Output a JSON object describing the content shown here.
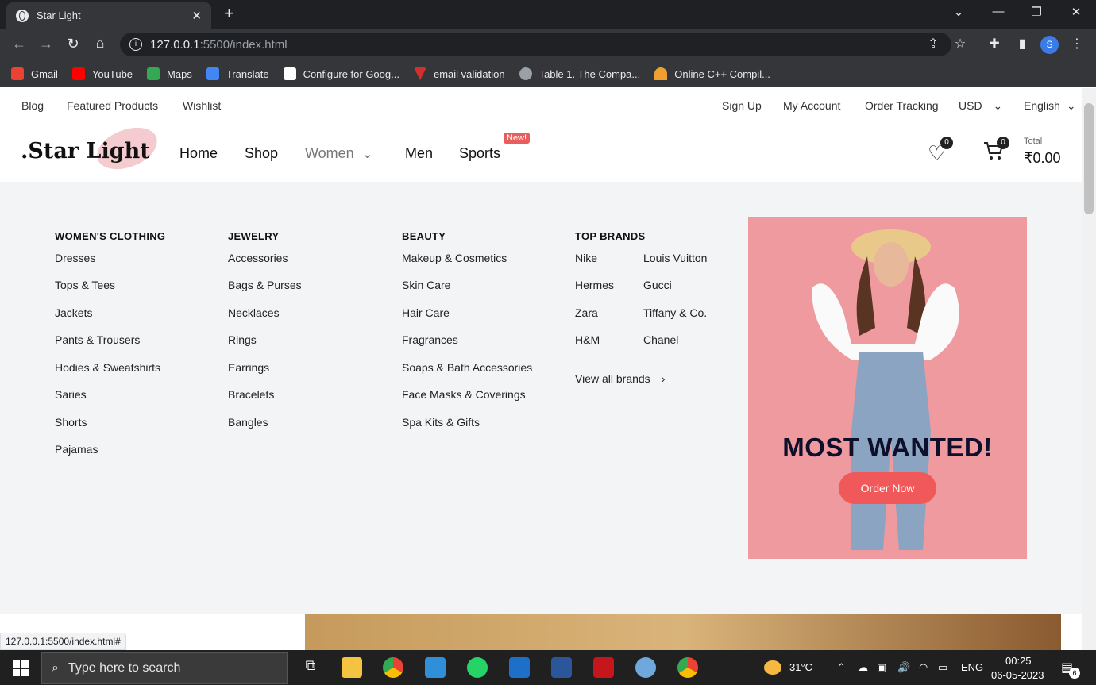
{
  "browser": {
    "tab_title": "Star Light",
    "new_tab": "+",
    "url_host": "127.0.0.1",
    "url_path": ":5500/index.html",
    "profile_initial": "S",
    "window_controls": [
      "⌄",
      "—",
      "❐",
      "✕"
    ],
    "bookmarks": [
      {
        "label": "Gmail",
        "color": "#ea4335"
      },
      {
        "label": "YouTube",
        "color": "#ff0000"
      },
      {
        "label": "Maps",
        "color": "#34a853"
      },
      {
        "label": "Translate",
        "color": "#4285f4"
      },
      {
        "label": "Configure for Goog...",
        "color": "#ffffff"
      },
      {
        "label": "email validation",
        "color": "#d32f2f"
      },
      {
        "label": "Table 1. The Compa...",
        "color": "#9aa0a6"
      },
      {
        "label": "Online C++ Compil...",
        "color": "#f0a030"
      }
    ],
    "status_url": "127.0.0.1:5500/index.html#"
  },
  "topbar": {
    "left": [
      "Blog",
      "Featured Products",
      "Wishlist"
    ],
    "right": [
      "Sign Up",
      "My Account",
      "Order Tracking"
    ],
    "currency": "USD",
    "language": "English"
  },
  "header": {
    "logo": ".Star Light",
    "nav": [
      "Home",
      "Shop",
      "Women",
      "Men",
      "Sports"
    ],
    "new_badge": "New!",
    "wishlist_count": "0",
    "cart_count": "0",
    "total_label": "Total",
    "total_value": "₹0.00"
  },
  "mega": {
    "col1": {
      "title": "WOMEN'S CLOTHING",
      "items": [
        "Dresses",
        "Tops & Tees",
        "Jackets",
        "Pants & Trousers",
        "Hodies & Sweatshirts",
        "Saries",
        "Shorts",
        "Pajamas"
      ]
    },
    "col2": {
      "title": "JEWELRY",
      "items": [
        "Accessories",
        "Bags & Purses",
        "Necklaces",
        "Rings",
        "Earrings",
        "Bracelets",
        "Bangles"
      ]
    },
    "col3": {
      "title": "BEAUTY",
      "items": [
        "Makeup & Cosmetics",
        "Skin Care",
        "Hair Care",
        "Fragrances",
        "Soaps & Bath Accessories",
        "Face Masks & Coverings",
        "Spa Kits & Gifts"
      ]
    },
    "col4": {
      "title": "TOP BRANDS",
      "brands_a": [
        "Nike",
        "Hermes",
        "Zara",
        "H&M"
      ],
      "brands_b": [
        "Louis Vuitton",
        "Gucci",
        "Tiffany & Co.",
        "Chanel"
      ],
      "view_all": "View all brands"
    },
    "promo": {
      "headline": "MOST WANTED!",
      "button": "Order Now"
    }
  },
  "taskbar": {
    "search_placeholder": "Type here to search",
    "temperature": "31°C",
    "lang": "ENG",
    "time": "00:25",
    "date": "06-05-2023",
    "notifications": "6"
  }
}
